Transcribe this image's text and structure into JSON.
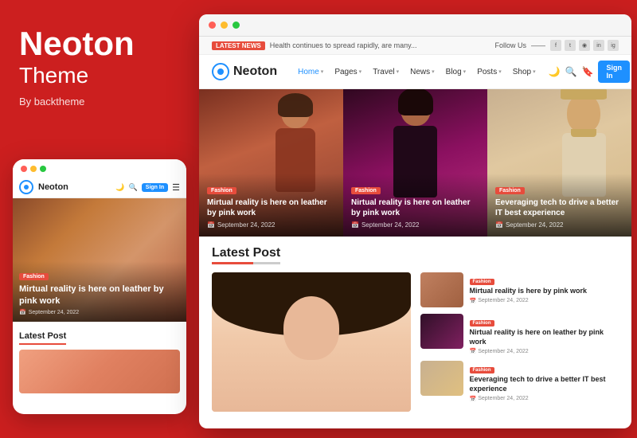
{
  "brand": {
    "name": "Neoton",
    "subtitle": "Theme",
    "by": "By backtheme"
  },
  "browser": {
    "dots": [
      "red",
      "yellow",
      "green"
    ]
  },
  "topbar": {
    "latest_label": "LATEST NEWS",
    "news_text": "Health continues to spread rapidly, are many...",
    "follow_label": "Follow Us"
  },
  "navbar": {
    "logo_text": "Neoton",
    "items": [
      {
        "label": "Home",
        "has_dropdown": true,
        "active": true
      },
      {
        "label": "Pages",
        "has_dropdown": true
      },
      {
        "label": "Travel",
        "has_dropdown": true
      },
      {
        "label": "News",
        "has_dropdown": true
      },
      {
        "label": "Blog",
        "has_dropdown": true
      },
      {
        "label": "Posts",
        "has_dropdown": true
      },
      {
        "label": "Shop",
        "has_dropdown": true
      }
    ],
    "sign_in": "Sign In"
  },
  "hero_cards": [
    {
      "badge": "Fashion",
      "title": "Mirtual reality is here on leather by pink work",
      "date": "September 24, 2022"
    },
    {
      "badge": "Fashion",
      "title": "Nirtual reality is here on leather by pink work",
      "date": "September 24, 2022"
    },
    {
      "badge": "Fashion",
      "title": "Eeveraging tech to drive a better IT best experience",
      "date": "September 24, 2022"
    }
  ],
  "latest_section": {
    "title": "Latest Post"
  },
  "side_posts": [
    {
      "badge": "Fashion",
      "title": "Mirtual reality is here by pink work",
      "date": "September 24, 2022"
    },
    {
      "badge": "Fashion",
      "title": "Nirtual reality is here on leather by pink work",
      "date": "September 24, 2022"
    },
    {
      "badge": "Fashion",
      "title": "Eeveraging tech to drive a better IT best experience",
      "date": "September 24, 2022"
    }
  ],
  "mobile": {
    "nav_brand": "Neoton",
    "sign_in": "Sign In",
    "hero_badge": "Fashion",
    "hero_title": "Mirtual reality is here on leather by pink work",
    "hero_date": "September 24, 2022",
    "latest_title": "Latest Post"
  }
}
